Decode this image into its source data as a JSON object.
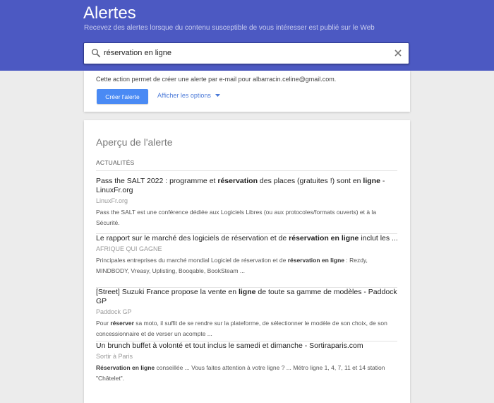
{
  "header": {
    "title": "Alertes",
    "subtitle": "Recevez des alertes lorsque du contenu susceptible de vous intéresser est publié sur le Web",
    "background": "#4c59c2"
  },
  "search": {
    "value": "réservation en ligne",
    "icon": "search-icon",
    "clear_icon": "close-icon"
  },
  "options": {
    "info_text": "Cette action permet de créer une alerte par e-mail pour albarracin.celine@gmail.com.",
    "create_button": "Créer l'alerte",
    "show_options_link": "Afficher les options",
    "accent": "#4a8af4"
  },
  "preview": {
    "title": "Aperçu de l'alerte",
    "section_label": "ACTUALITÉS",
    "results": [
      {
        "title_parts": [
          "Pass the SALT 2022 : programme et ",
          "réservation",
          " des places (gratuites !) sont en ",
          "ligne",
          " - LinuxFr.org"
        ],
        "source": "LinuxFr.org",
        "snippet_parts": [
          "Pass the SALT est une conférence dédiée aux Logiciels Libres (ou aux protocoles/formats ouverts) et à la Sécurité."
        ]
      },
      {
        "title_parts": [
          "Le rapport sur le marché des logiciels de réservation et de ",
          "réservation en ligne",
          " inclut les ..."
        ],
        "source": "AFRIQUE QUI GAGNE",
        "snippet_parts": [
          "Principales entreprises du marché mondial Logiciel de réservation et de ",
          "réservation en ligne",
          " : Rezdy, MINDBODY, Vreasy, Uplisting, Booqable, BookSteam ..."
        ]
      },
      {
        "title_parts": [
          "[Street] Suzuki France propose la vente en ",
          "ligne",
          " de toute sa gamme de modèles - Paddock GP"
        ],
        "source": "Paddock GP",
        "snippet_parts": [
          "Pour ",
          "réserver",
          " sa moto, il suffit de se rendre sur la plateforme, de sélectionner le modèle de son choix, de son concessionnaire et de verser un acompte ..."
        ]
      },
      {
        "title_parts": [
          "Un brunch buffet à volonté et tout inclus le samedi et dimanche - Sortiraparis.com"
        ],
        "source": "Sortir à Paris",
        "snippet_parts": [
          "Réservation en ligne",
          " conseillée ... Vous faites attention à votre ligne ? ... Métro ligne 1, 4, 7, 11 et 14 station \"Châtelet\"."
        ]
      }
    ]
  }
}
